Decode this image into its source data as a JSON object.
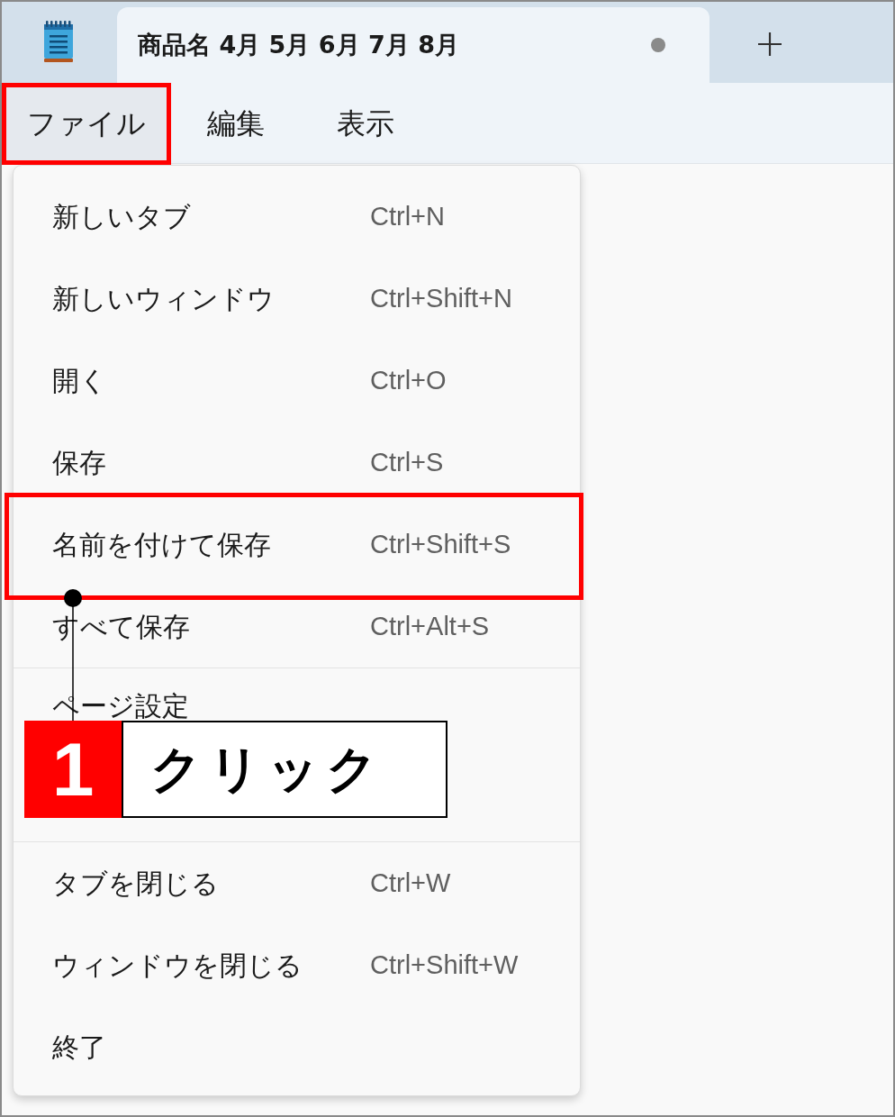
{
  "title_bar": {
    "tab": {
      "title": "商品名 4月 5月 6月 7月 8月",
      "selected": true,
      "unsaved": true
    }
  },
  "menu_bar": {
    "items": [
      {
        "label": "ファイル",
        "open": true,
        "highlighted": true
      },
      {
        "label": "編集",
        "open": false,
        "highlighted": false
      },
      {
        "label": "表示",
        "open": false,
        "highlighted": false
      }
    ]
  },
  "file_menu": {
    "groups": [
      {
        "items": [
          {
            "label": "新しいタブ",
            "shortcut": "Ctrl+N",
            "highlighted": false
          },
          {
            "label": "新しいウィンドウ",
            "shortcut": "Ctrl+Shift+N",
            "highlighted": false
          },
          {
            "label": "開く",
            "shortcut": "Ctrl+O",
            "highlighted": false
          },
          {
            "label": "保存",
            "shortcut": "Ctrl+S",
            "highlighted": false
          },
          {
            "label": "名前を付けて保存",
            "shortcut": "Ctrl+Shift+S",
            "highlighted": true
          },
          {
            "label": "すべて保存",
            "shortcut": "Ctrl+Alt+S",
            "highlighted": false
          }
        ]
      },
      {
        "items": [
          {
            "label": "ページ設定",
            "highlighted": false
          }
        ]
      },
      {
        "items": [
          {
            "label": "タブを閉じる",
            "shortcut": "Ctrl+W",
            "highlighted": false
          },
          {
            "label": "ウィンドウを閉じる",
            "shortcut": "Ctrl+Shift+W",
            "highlighted": false
          },
          {
            "label": "終了",
            "highlighted": false
          }
        ]
      }
    ]
  },
  "callout": {
    "step": "1",
    "text": "クリック"
  }
}
